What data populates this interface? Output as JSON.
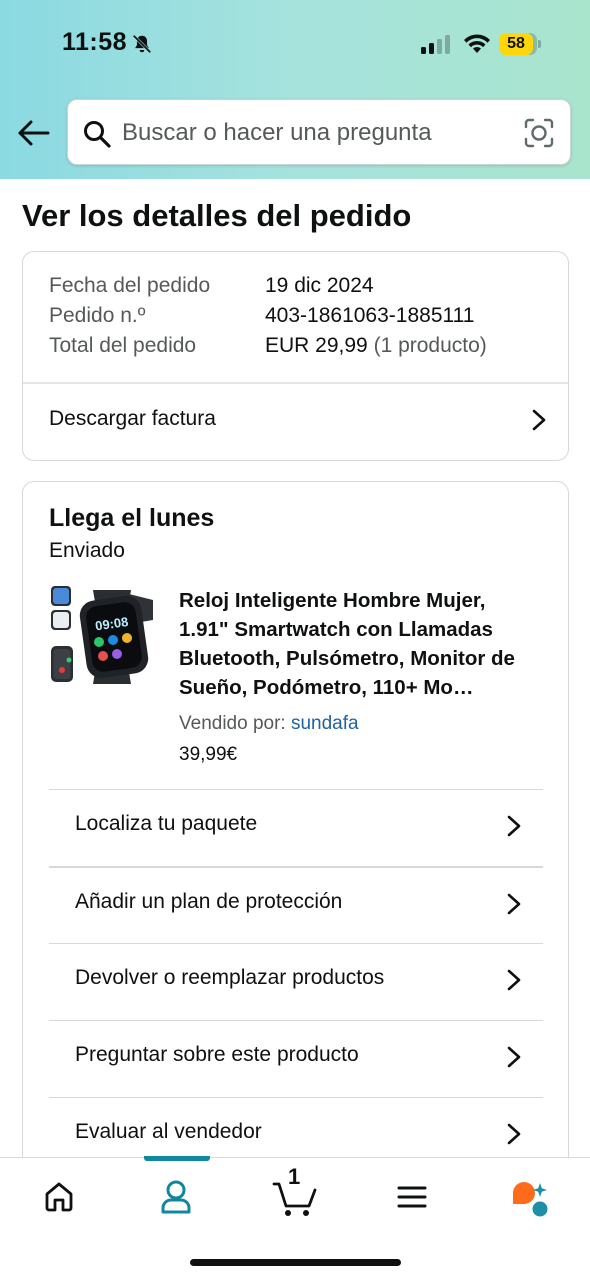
{
  "status_bar": {
    "time": "11:58",
    "battery": "58"
  },
  "search": {
    "placeholder": "Buscar o hacer una pregunta"
  },
  "page_title": "Ver los detalles del pedido",
  "order": {
    "date_label": "Fecha del pedido",
    "date_value": "19 dic 2024",
    "number_label": "Pedido n.º",
    "number_value": "403-1861063-1885111",
    "total_label": "Total del pedido",
    "total_value": "EUR 29,99",
    "total_count": "(1 producto)",
    "invoice_label": "Descargar factura"
  },
  "delivery": {
    "title": "Llega el lunes",
    "status": "Enviado",
    "product": {
      "title": "Reloj Inteligente Hombre Mujer, 1.91\" Smartwatch con Llamadas Bluetooth, Pulsómetro, Monitor de Sueño, Podómetro, 110+ Mo…",
      "seller_label": "Vendido por:",
      "seller_name": "sundafa",
      "price": "39,99€"
    },
    "actions": [
      {
        "label": "Localiza tu paquete"
      },
      {
        "label": "Añadir un plan de protección"
      },
      {
        "label": "Devolver o reemplazar productos"
      },
      {
        "label": "Preguntar sobre este producto"
      },
      {
        "label": "Evaluar al vendedor"
      }
    ]
  },
  "bottom_nav": {
    "items": [
      "home-icon",
      "account-icon",
      "cart-icon",
      "menu-icon",
      "rufus-icon"
    ],
    "active": "account-icon",
    "cart_count": "1"
  },
  "colors": {
    "accent": "#11879f",
    "link": "#2162a1",
    "header_start": "#8bd9e2",
    "header_end": "#a9e4cd",
    "battery": "#ffd60a",
    "rufus_orange": "#ff6b1a"
  }
}
